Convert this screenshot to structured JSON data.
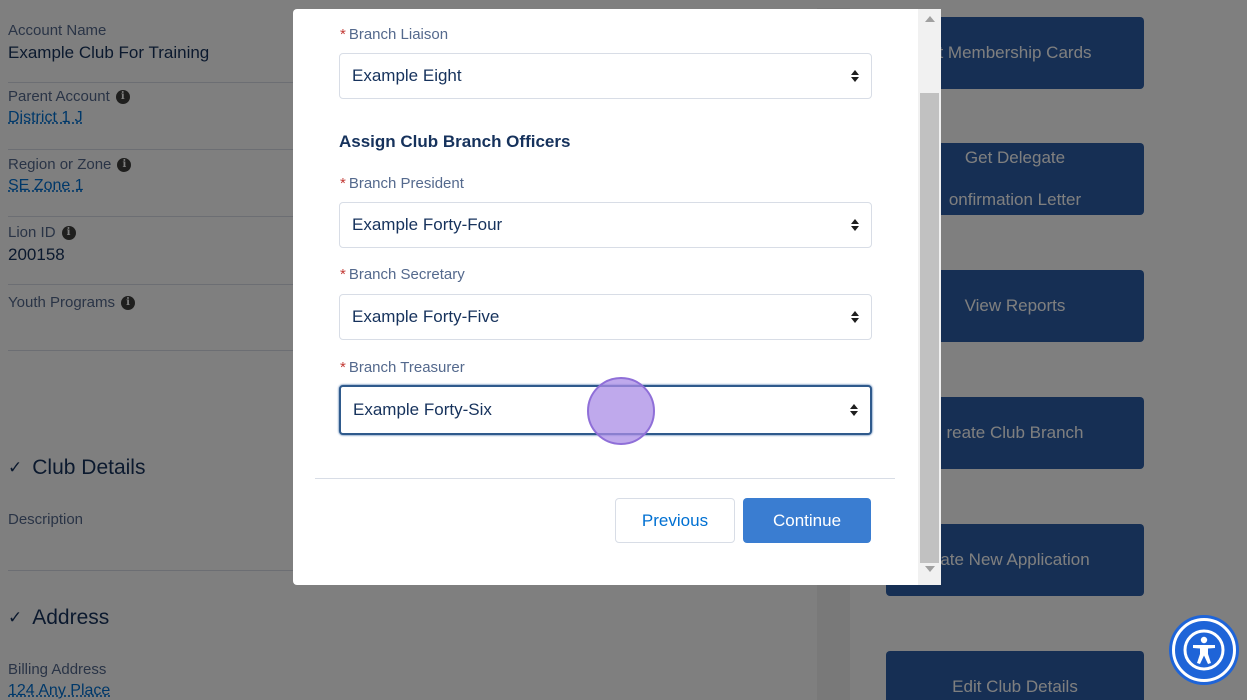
{
  "background": {
    "fields": {
      "account_name_label": "Account Name",
      "account_name_value": "Example Club For Training",
      "parent_account_label": "Parent Account",
      "parent_account_value": "District 1 J",
      "region_label": "Region or Zone",
      "region_value": "SE Zone 1",
      "lion_id_label": "Lion ID",
      "lion_id_value": "200158",
      "youth_programs_label": "Youth Programs",
      "description_label": "Description",
      "billing_address_label": "Billing Address",
      "billing_address_value": "124 Any Place"
    },
    "sections": {
      "club_details": "Club Details",
      "address": "Address"
    },
    "actions": {
      "membership_cards": "t Membership Cards",
      "delegate_line1": "Get Delegate",
      "delegate_line2": "onfirmation Letter",
      "view_reports": "View Reports",
      "create_branch": "reate Club Branch",
      "new_application": "ate New Application",
      "edit_club": "Edit Club Details"
    }
  },
  "modal": {
    "liaison_label": "Branch Liaison",
    "liaison_value": "Example Eight",
    "officers_heading": "Assign Club Branch Officers",
    "president_label": "Branch President",
    "president_value": "Example Forty-Four",
    "secretary_label": "Branch Secretary",
    "secretary_value": "Example Forty-Five",
    "treasurer_label": "Branch Treasurer",
    "treasurer_value": "Example Forty-Six",
    "required_mark": "*",
    "previous_label": "Previous",
    "continue_label": "Continue"
  },
  "icons": {
    "info": "i",
    "check": "✓"
  },
  "colors": {
    "primary_button": "#3a7dd1",
    "side_button": "#2d5fa8",
    "required": "#c23934",
    "accessibility": "#1e64d8"
  }
}
